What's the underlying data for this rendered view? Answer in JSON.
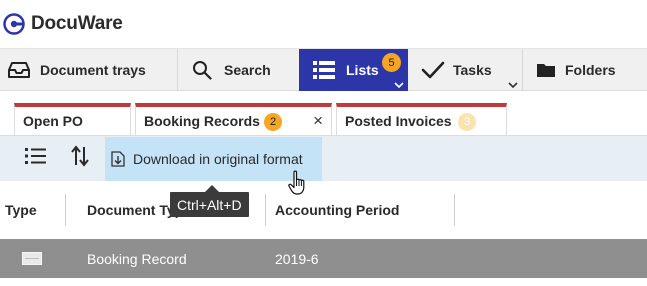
{
  "app": {
    "title": "DocuWare",
    "brand_color": "#2d36a8"
  },
  "nav": {
    "items": [
      {
        "label": "Document trays",
        "icon": "tray-icon"
      },
      {
        "label": "Search",
        "icon": "search-icon"
      },
      {
        "label": "Lists",
        "icon": "list-icon",
        "badge": "5",
        "active": true
      },
      {
        "label": "Tasks",
        "icon": "checkmark-icon"
      },
      {
        "label": "Folders",
        "icon": "folder-icon"
      }
    ]
  },
  "tabs": [
    {
      "label": "Open PO"
    },
    {
      "label": "Booking Records",
      "badge": "2",
      "active": true,
      "close": "×"
    },
    {
      "label": "Posted Invoices",
      "badge": "3"
    }
  ],
  "toolbar": {
    "download_label": "Download in original format",
    "tooltip": "Ctrl+Alt+D"
  },
  "table": {
    "columns": [
      "Type",
      "Document Type",
      "Accounting Period"
    ],
    "rows": [
      {
        "type_icon": "document-icon",
        "document_type": "Booking Record",
        "accounting_period": "2019-6"
      }
    ]
  }
}
